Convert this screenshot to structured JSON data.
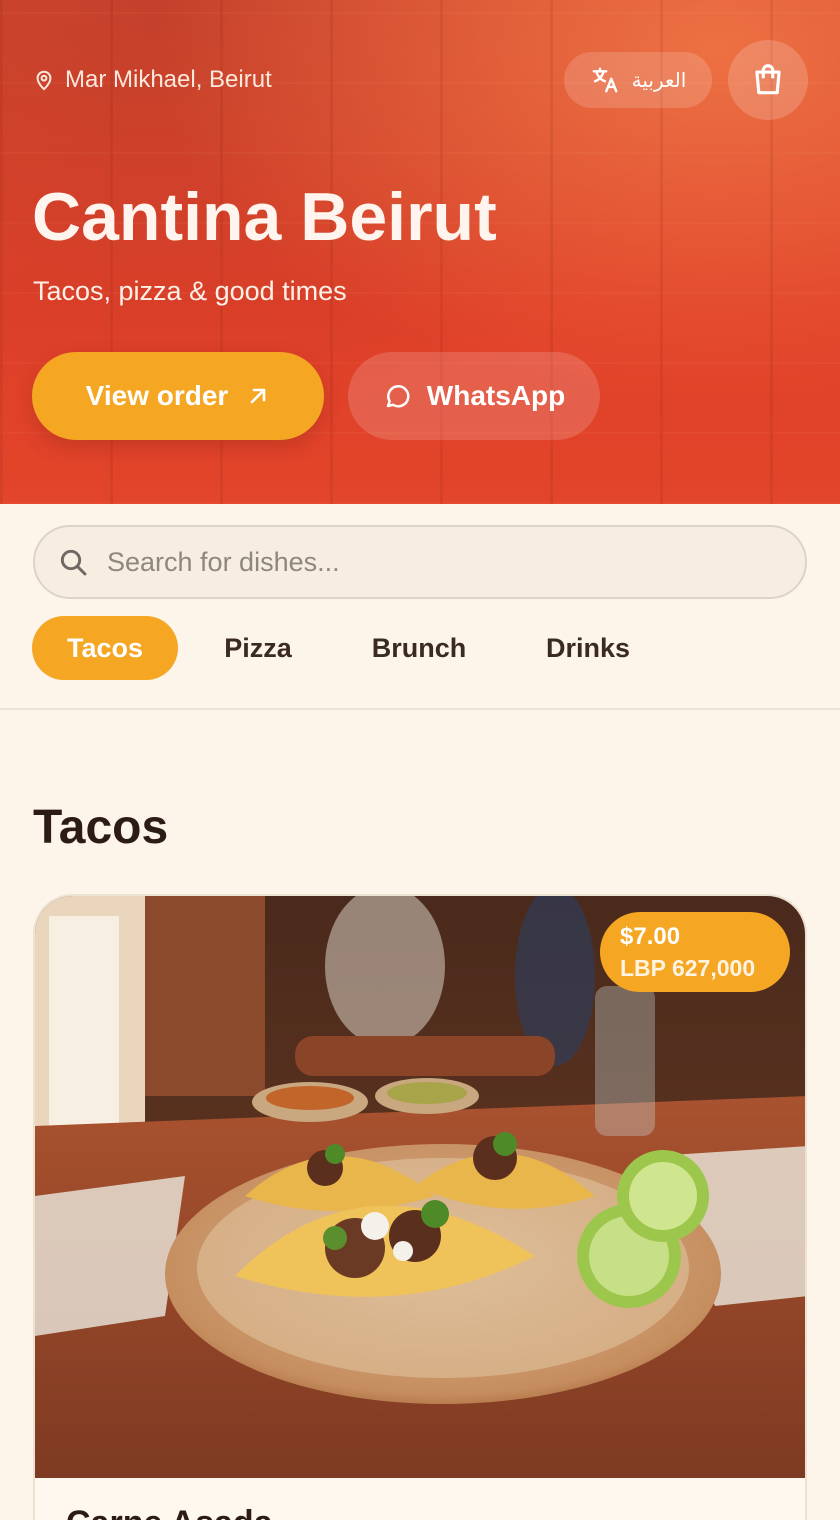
{
  "hero": {
    "location": "Mar Mikhael, Beirut",
    "language_label": "العربية",
    "title": "Cantina Beirut",
    "tagline": "Tacos, pizza & good times",
    "view_order_label": "View order",
    "whatsapp_label": "WhatsApp"
  },
  "search": {
    "placeholder": "Search for dishes..."
  },
  "categories": [
    {
      "label": "Tacos",
      "active": true
    },
    {
      "label": "Pizza",
      "active": false
    },
    {
      "label": "Brunch",
      "active": false
    },
    {
      "label": "Drinks",
      "active": false
    }
  ],
  "menu": {
    "section_title": "Tacos",
    "items": [
      {
        "price_usd": "$7.00",
        "price_lbp": "LBP 627,000",
        "name": "Carne Asada"
      }
    ]
  },
  "colors": {
    "hero_red": "#e03f28",
    "accent_orange": "#f5a623",
    "page_background": "#fdf5ea",
    "heading_dark": "#2c1c15"
  },
  "icons": {
    "location": "location-pin-icon",
    "language": "translate-icon",
    "cart": "shopping-bag-icon",
    "view_order": "arrow-up-right-icon",
    "whatsapp": "chat-bubble-icon",
    "search": "search-icon"
  }
}
